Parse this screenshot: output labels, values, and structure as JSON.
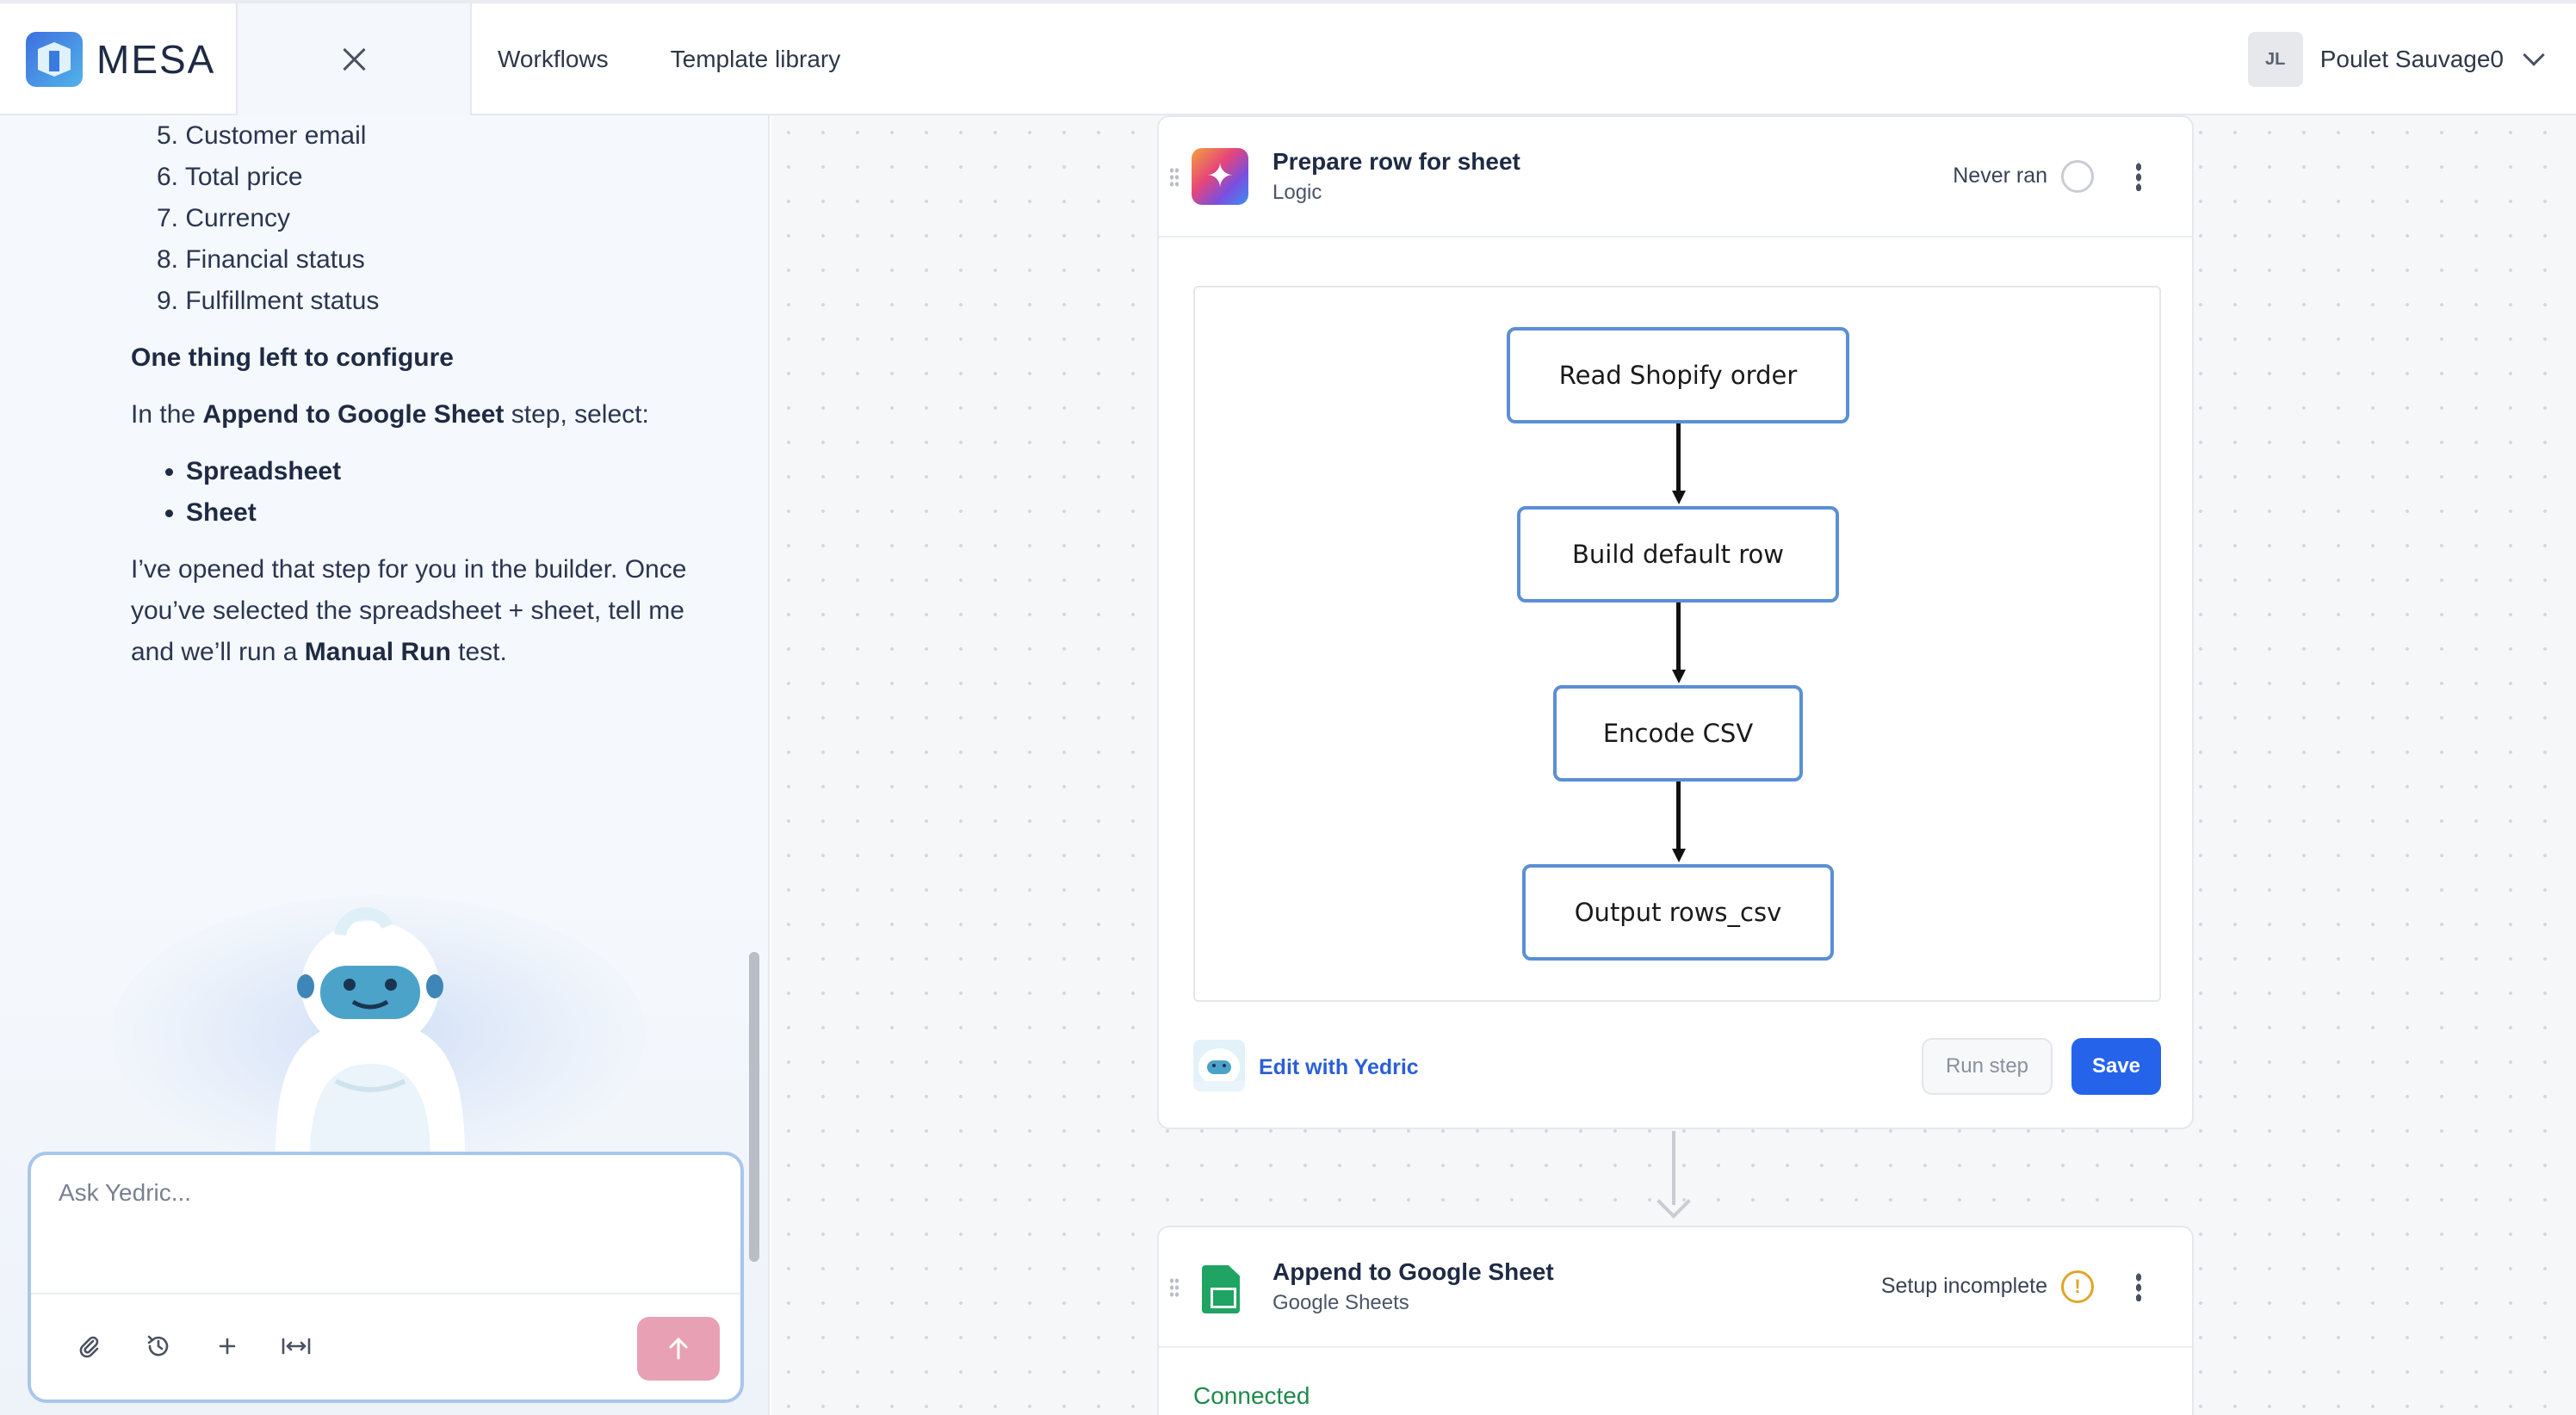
{
  "header": {
    "brand": "MESA",
    "nav": [
      "Workflows",
      "Template library"
    ],
    "user_initials": "JL",
    "user_name": "Poulet Sauvage0"
  },
  "chat": {
    "numbered_items": [
      "5. Customer email",
      "6. Total price",
      "7. Currency",
      "8. Financial status",
      "9. Fulfillment status"
    ],
    "heading": "One thing left to configure",
    "instruction_prefix": "In the ",
    "instruction_bold": "Append to Google Sheet",
    "instruction_suffix": " step, select:",
    "bullets": [
      "Spreadsheet",
      "Sheet"
    ],
    "para_part1": "I’ve opened that step for you in the builder. Once you’ve selected the spreadsheet + sheet, tell me and we’ll run a ",
    "para_bold": "Manual Run",
    "para_part2": " test.",
    "input_placeholder": "Ask Yedric..."
  },
  "step1": {
    "title": "Prepare row for sheet",
    "subtitle": "Logic",
    "status": "Never ran",
    "diagram_nodes": [
      "Read Shopify order",
      "Build default row",
      "Encode CSV",
      "Output rows_csv"
    ],
    "edit_link": "Edit with Yedric",
    "run_label": "Run step",
    "save_label": "Save"
  },
  "step2": {
    "title": "Append to Google Sheet",
    "subtitle": "Google Sheets",
    "status": "Setup incomplete",
    "connection": "Connected"
  },
  "colors": {
    "accent": "#2563eb",
    "send_button": "#e8a0b4",
    "node_border": "#5b8fd6",
    "warning": "#e0a52a"
  }
}
